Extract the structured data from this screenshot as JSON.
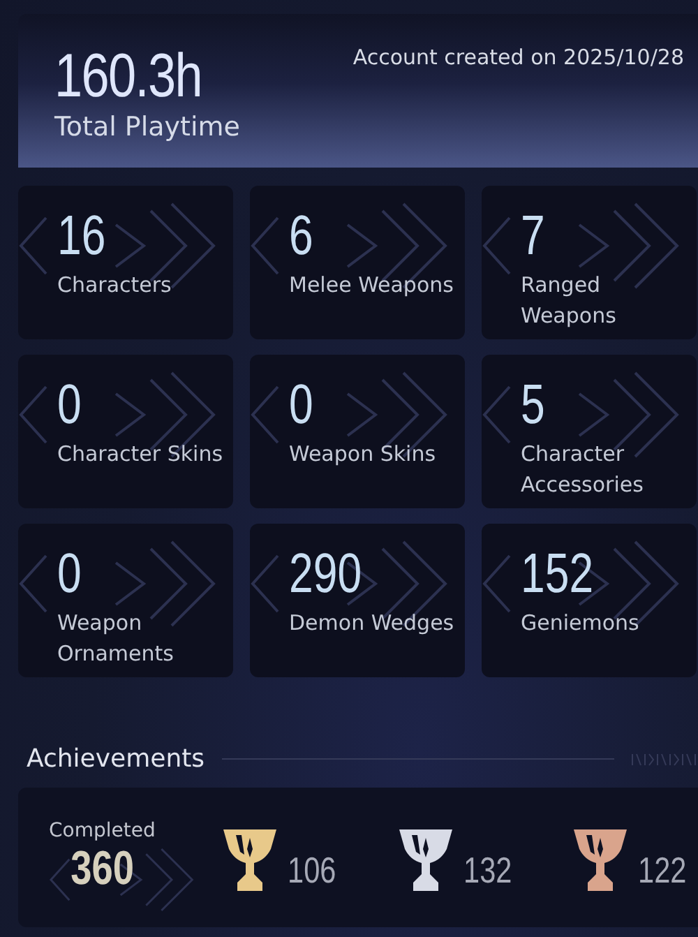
{
  "summary": {
    "playtime": "160.3h",
    "playtime_label": "Total Playtime",
    "created_label": "Account created on",
    "created_date": "2025/10/28"
  },
  "stats": [
    {
      "value": "16",
      "label": "Characters"
    },
    {
      "value": "6",
      "label": "Melee Weapons"
    },
    {
      "value": "7",
      "label": "Ranged Weapons"
    },
    {
      "value": "0",
      "label": "Character Skins"
    },
    {
      "value": "0",
      "label": "Weapon Skins"
    },
    {
      "value": "5",
      "label": "Character Accessories"
    },
    {
      "value": "0",
      "label": "Weapon Ornaments"
    },
    {
      "value": "290",
      "label": "Demon Wedges"
    },
    {
      "value": "152",
      "label": "Geniemons"
    }
  ],
  "achievements": {
    "title": "Achievements",
    "completed_label": "Completed",
    "completed_value": "360",
    "trophies": [
      {
        "count": "106",
        "color": "#e8c98a"
      },
      {
        "count": "132",
        "color": "#d8dbe6"
      },
      {
        "count": "122",
        "color": "#d9a48c"
      }
    ]
  }
}
